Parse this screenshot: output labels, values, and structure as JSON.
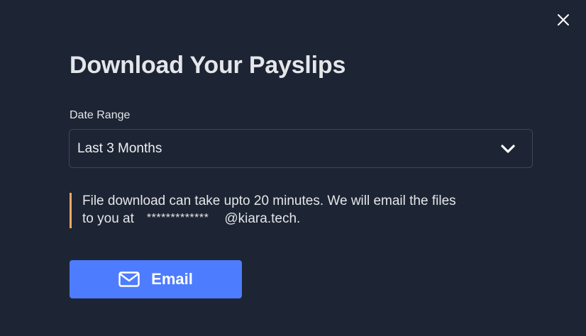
{
  "dialog": {
    "title": "Download Your Payslips",
    "close_icon": "close-icon"
  },
  "date_range": {
    "label": "Date Range",
    "selected": "Last 3 Months",
    "icon": "chevron-down-icon"
  },
  "notice": {
    "line1": "File download can take upto 20 minutes. We will email the files",
    "line2_prefix": "to you at",
    "masked_email": "*************",
    "email_domain": "@kiara.tech.",
    "accent_color": "#f0a864"
  },
  "actions": {
    "email_label": "Email",
    "email_icon": "mail-icon",
    "button_color": "#4d7cfe"
  }
}
